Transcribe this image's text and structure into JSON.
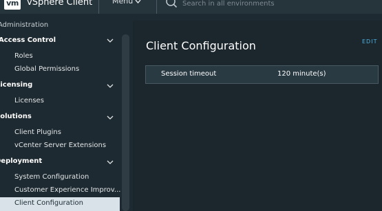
{
  "header": {
    "logo_text": "vm",
    "app_title": "vSphere Client",
    "menu_label": "Menu",
    "search_placeholder": "Search in all environments"
  },
  "sidebar": {
    "top_label": "Administration",
    "sections": [
      {
        "label": "Access Control",
        "items": [
          "Roles",
          "Global Permissions"
        ]
      },
      {
        "label": "Licensing",
        "items": [
          "Licenses"
        ]
      },
      {
        "label": "Solutions",
        "items": [
          "Client Plugins",
          "vCenter Server Extensions"
        ]
      },
      {
        "label": "Deployment",
        "items": [
          "System Configuration",
          "Customer Experience Improv...",
          "Client Configuration"
        ]
      }
    ],
    "active_item": "Client Configuration"
  },
  "main": {
    "title": "Client Configuration",
    "edit_label": "EDIT",
    "settings": [
      {
        "key": "Session timeout",
        "value": "120 minute(s)"
      }
    ]
  },
  "colors": {
    "header_bg": "#26343c",
    "sidebar_bg": "#1e2a31",
    "main_bg": "#1b262d",
    "active_bg": "#d8e2e8",
    "link": "#4fb3e3"
  }
}
